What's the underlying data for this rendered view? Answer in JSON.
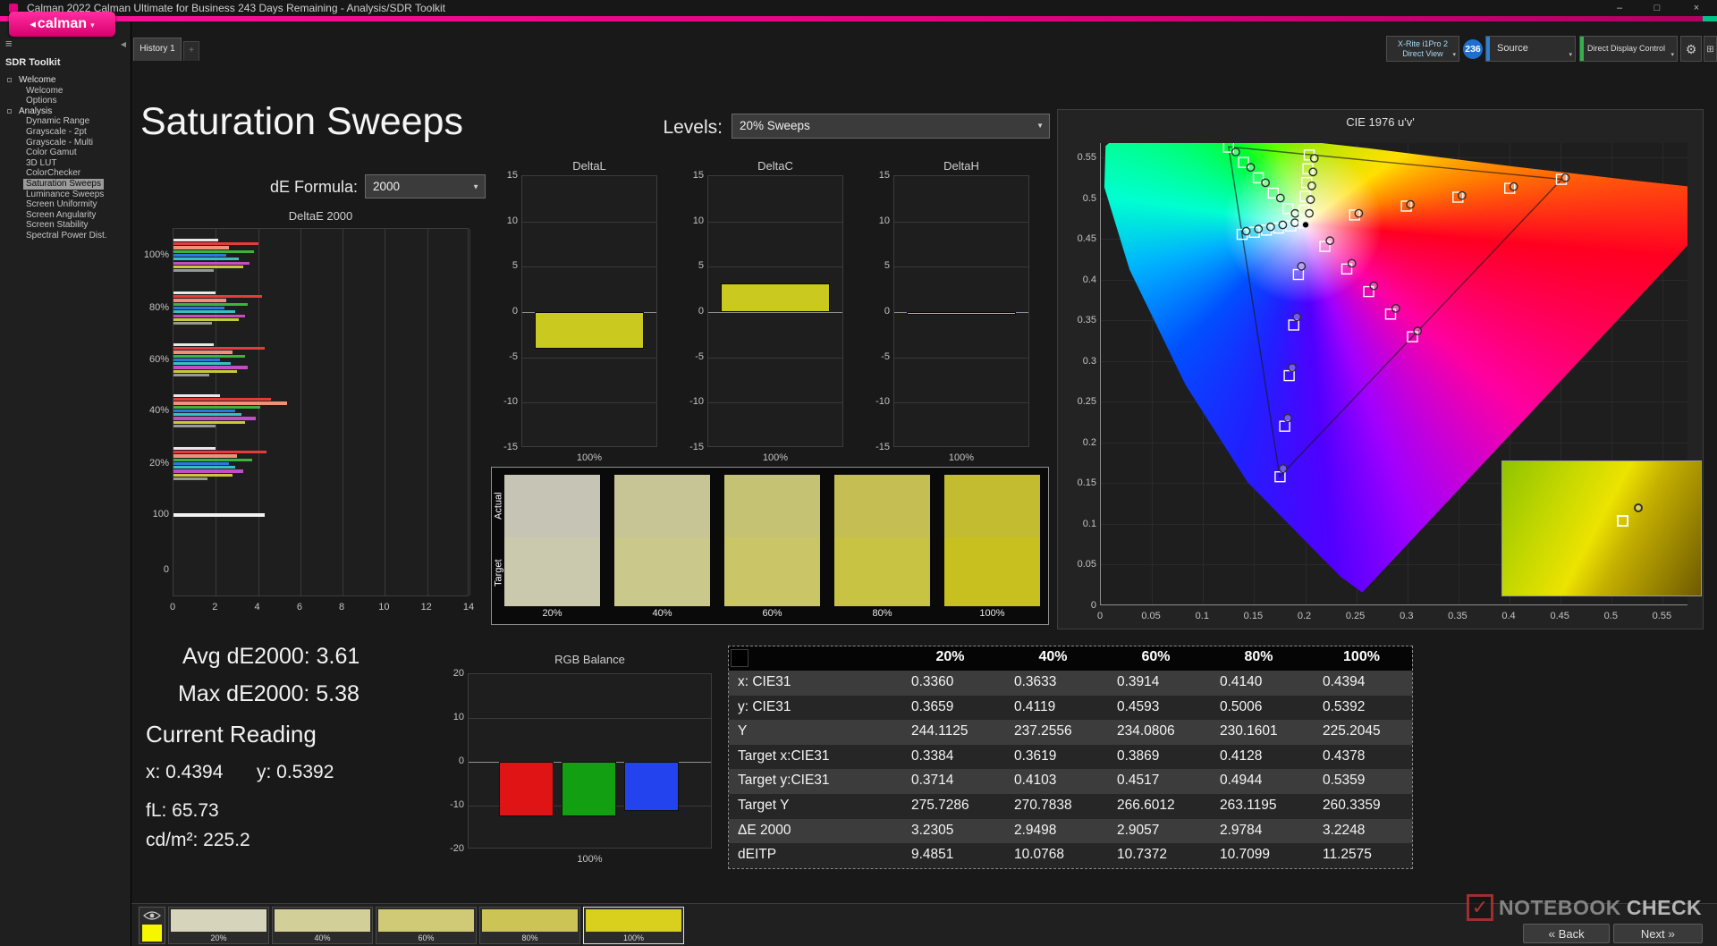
{
  "titlebar": {
    "title": "Calman 2022 Calman Ultimate for Business 243 Days Remaining  - Analysis/SDR Toolkit",
    "minimize": "–",
    "maximize": "□",
    "close": "×"
  },
  "logo": {
    "label": "calman",
    "accent": "#e6007e"
  },
  "tabs": {
    "history": "History 1"
  },
  "toolbar": {
    "meter_line1": "X-Rite i1Pro 2",
    "meter_line2": "Direct View",
    "badge": "236",
    "source_label": "Source",
    "display_control_label": "Direct Display Control"
  },
  "sidebar": {
    "header": "SDR Toolkit",
    "items": [
      {
        "label": "Welcome",
        "level": 0
      },
      {
        "label": "Welcome",
        "level": 1
      },
      {
        "label": "Options",
        "level": 1
      },
      {
        "label": "Analysis",
        "level": 0
      },
      {
        "label": "Dynamic Range",
        "level": 1
      },
      {
        "label": "Grayscale - 2pt",
        "level": 1
      },
      {
        "label": "Grayscale - Multi",
        "level": 1
      },
      {
        "label": "Color Gamut",
        "level": 1
      },
      {
        "label": "3D LUT",
        "level": 1
      },
      {
        "label": "ColorChecker",
        "level": 1
      },
      {
        "label": "Saturation Sweeps",
        "level": 1,
        "selected": true
      },
      {
        "label": "Luminance Sweeps",
        "level": 1
      },
      {
        "label": "Screen Uniformity",
        "level": 1
      },
      {
        "label": "Screen Angularity",
        "level": 1
      },
      {
        "label": "Screen Stability",
        "level": 1
      },
      {
        "label": "Spectral Power Dist.",
        "level": 1
      }
    ]
  },
  "page": {
    "title": "Saturation Sweeps",
    "levels_label": "Levels:",
    "levels_value": "20% Sweeps",
    "de_formula_label": "dE Formula:",
    "de_formula_value": "2000"
  },
  "readings": {
    "avg": "Avg dE2000: 3.61",
    "max": "Max dE2000: 5.38",
    "heading": "Current Reading",
    "x": "x: 0.4394",
    "y": "y: 0.5392",
    "fl": "fL: 65.73",
    "cdm2": "cd/m²: 225.2"
  },
  "table": {
    "columns": [
      "20%",
      "40%",
      "60%",
      "80%",
      "100%"
    ],
    "rows": [
      {
        "label": "x: CIE31",
        "values": [
          "0.3360",
          "0.3633",
          "0.3914",
          "0.4140",
          "0.4394"
        ]
      },
      {
        "label": "y: CIE31",
        "values": [
          "0.3659",
          "0.4119",
          "0.4593",
          "0.5006",
          "0.5392"
        ]
      },
      {
        "label": "Y",
        "values": [
          "244.1125",
          "237.2556",
          "234.0806",
          "230.1601",
          "225.2045"
        ]
      },
      {
        "label": "Target x:CIE31",
        "values": [
          "0.3384",
          "0.3619",
          "0.3869",
          "0.4128",
          "0.4378"
        ]
      },
      {
        "label": "Target y:CIE31",
        "values": [
          "0.3714",
          "0.4103",
          "0.4517",
          "0.4944",
          "0.5359"
        ]
      },
      {
        "label": "Target Y",
        "values": [
          "275.7286",
          "270.7838",
          "266.6012",
          "263.1195",
          "260.3359"
        ]
      },
      {
        "label": "ΔE 2000",
        "values": [
          "3.2305",
          "2.9498",
          "2.9057",
          "2.9784",
          "3.2248"
        ]
      },
      {
        "label": "dEITP",
        "values": [
          "9.4851",
          "10.0768",
          "10.7372",
          "10.7099",
          "11.2575"
        ]
      }
    ]
  },
  "bottom": {
    "back": "Back",
    "next": "Next",
    "swatches": [
      {
        "label": "20%",
        "color": "#d6d4ba"
      },
      {
        "label": "40%",
        "color": "#d3cf99"
      },
      {
        "label": "60%",
        "color": "#d0ca77"
      },
      {
        "label": "80%",
        "color": "#ccc455"
      },
      {
        "label": "100%",
        "color": "#d8d01d",
        "selected": true
      }
    ]
  },
  "watermark": {
    "text1": "NOTEBOOK",
    "text2": "CHECK"
  },
  "chart_data": [
    {
      "id": "deltaE2000",
      "type": "bar",
      "orientation": "horizontal",
      "title": "DeltaE 2000",
      "xlim": [
        0,
        14
      ],
      "xticks": [
        0,
        2,
        4,
        6,
        8,
        10,
        12,
        14
      ],
      "ylabels": [
        "100%",
        "80%",
        "60%",
        "40%",
        "20%",
        "100",
        "0"
      ],
      "palette": [
        "#e8e8e8",
        "#e43c3c",
        "#f0907a",
        "#3cb43c",
        "#2c78e0",
        "#38c0c0",
        "#c44cc4",
        "#c8c83c",
        "#989898"
      ],
      "groups": [
        {
          "label": "100%",
          "values": [
            2.1,
            4.0,
            2.6,
            3.8,
            2.5,
            3.1,
            3.6,
            3.3,
            1.9
          ]
        },
        {
          "label": "80%",
          "values": [
            2.0,
            4.2,
            2.5,
            3.5,
            2.4,
            2.9,
            3.4,
            3.1,
            1.8
          ]
        },
        {
          "label": "60%",
          "values": [
            1.9,
            4.3,
            2.8,
            3.4,
            2.2,
            2.7,
            3.5,
            3.0,
            1.7
          ]
        },
        {
          "label": "40%",
          "values": [
            2.2,
            4.6,
            5.38,
            4.1,
            2.9,
            3.2,
            3.9,
            3.4,
            2.0
          ]
        },
        {
          "label": "20%",
          "values": [
            2.0,
            4.4,
            3.0,
            3.7,
            2.6,
            2.9,
            3.3,
            2.8,
            1.6
          ]
        },
        {
          "label": "100",
          "values": [
            4.3
          ],
          "color": "#f2f2f2"
        }
      ]
    },
    {
      "id": "deltaL",
      "type": "bar",
      "title": "DeltaL",
      "category": "100%",
      "ylim": [
        -15,
        15
      ],
      "yticks": [
        15,
        10,
        5,
        0,
        -5,
        -10,
        -15
      ],
      "value": -4.0,
      "color": "#c9c920"
    },
    {
      "id": "deltaC",
      "type": "bar",
      "title": "DeltaC",
      "category": "100%",
      "ylim": [
        -15,
        15
      ],
      "yticks": [
        15,
        10,
        5,
        0,
        -5,
        -10,
        -15
      ],
      "value": 3.2,
      "color": "#c9c920"
    },
    {
      "id": "deltaH",
      "type": "bar",
      "title": "DeltaH",
      "category": "100%",
      "ylim": [
        -15,
        15
      ],
      "yticks": [
        15,
        10,
        5,
        0,
        -5,
        -10,
        -15
      ],
      "value": -0.3,
      "color": "#c9c920"
    },
    {
      "id": "rgb_balance",
      "type": "bar",
      "title": "RGB Balance",
      "category": "100%",
      "ylim": [
        -20,
        20
      ],
      "yticks": [
        20,
        10,
        0,
        -10,
        -20
      ],
      "series": [
        {
          "name": "Red",
          "value": -12.4,
          "color": "#e01414"
        },
        {
          "name": "Green",
          "value": -12.4,
          "color": "#12a012"
        },
        {
          "name": "Blue",
          "value": -11.2,
          "color": "#2343ee"
        }
      ]
    },
    {
      "id": "saturation_swatches",
      "type": "swatch-compare",
      "row_labels": [
        "Actual",
        "Target"
      ],
      "levels": [
        "20%",
        "40%",
        "60%",
        "80%",
        "100%"
      ],
      "actual": [
        "#c6c4b4",
        "#c7c495",
        "#c6c274",
        "#c5bf53",
        "#c3bb30"
      ],
      "target": [
        "#cac8ad",
        "#cbc88c",
        "#cac668",
        "#c9c344",
        "#c8c01f"
      ]
    },
    {
      "id": "cie",
      "type": "scatter",
      "title": "CIE 1976 u'v'",
      "xlim": [
        0,
        0.575
      ],
      "ylim": [
        0,
        0.5675
      ],
      "xticks": [
        0,
        0.05,
        0.1,
        0.15,
        0.2,
        0.25,
        0.3,
        0.35,
        0.4,
        0.45,
        0.5,
        0.55
      ],
      "xtick_labels": [
        "0",
        "0.05",
        "0.1",
        "0.15",
        "0.2",
        "0.25",
        "0.3",
        "0.35",
        "0.4",
        "0.45",
        "0.5",
        "0.55"
      ],
      "yticks": [
        0.55,
        0.5,
        0.45,
        0.4,
        0.35,
        0.3,
        0.25,
        0.2,
        0.15,
        0.1,
        0.05,
        0
      ],
      "ytick_labels": [
        "0.55",
        "0.5",
        "0.45",
        "0.4",
        "0.35",
        "0.3",
        "0.25",
        "0.2",
        "0.15",
        "0.1",
        "0.05",
        "0"
      ],
      "white_point": {
        "u": 0.1978,
        "v": 0.4683
      },
      "gamut_triangle": [
        [
          0.451,
          0.523
        ],
        [
          0.125,
          0.563
        ],
        [
          0.175,
          0.158
        ]
      ],
      "series": [
        {
          "name": "red-target",
          "marker": "square",
          "points": [
            [
              0.2484,
              0.4792
            ],
            [
              0.299,
              0.4901
            ],
            [
              0.3495,
              0.5011
            ],
            [
              0.4001,
              0.512
            ],
            [
              0.4507,
              0.5229
            ]
          ]
        },
        {
          "name": "red-measured",
          "marker": "circle",
          "points": [
            [
              0.2524,
              0.4812
            ],
            [
              0.303,
              0.4921
            ],
            [
              0.3535,
              0.5031
            ],
            [
              0.4041,
              0.514
            ],
            [
              0.4547,
              0.5249
            ]
          ]
        },
        {
          "name": "green-target",
          "marker": "square",
          "points": [
            [
              0.1832,
              0.4871
            ],
            [
              0.1687,
              0.506
            ],
            [
              0.1541,
              0.5248
            ],
            [
              0.1396,
              0.5437
            ],
            [
              0.125,
              0.5625
            ]
          ]
        },
        {
          "name": "green-measured",
          "marker": "circle",
          "points": [
            [
              0.1902,
              0.4811
            ],
            [
              0.1757,
              0.5
            ],
            [
              0.1611,
              0.5188
            ],
            [
              0.1466,
              0.5377
            ],
            [
              0.132,
              0.5565
            ]
          ]
        },
        {
          "name": "blue-target",
          "marker": "square",
          "points": [
            [
              0.1933,
              0.4062
            ],
            [
              0.1888,
              0.3441
            ],
            [
              0.1843,
              0.282
            ],
            [
              0.1799,
              0.2199
            ],
            [
              0.1754,
              0.1579
            ]
          ]
        },
        {
          "name": "blue-measured",
          "marker": "circle",
          "points": [
            [
              0.1963,
              0.4162
            ],
            [
              0.1918,
              0.3541
            ],
            [
              0.1873,
              0.292
            ],
            [
              0.1829,
              0.2299
            ],
            [
              0.1784,
              0.1679
            ]
          ]
        },
        {
          "name": "cyan-target",
          "marker": "square",
          "points": [
            [
              0.1859,
              0.4657
            ],
            [
              0.174,
              0.4631
            ],
            [
              0.1621,
              0.4606
            ],
            [
              0.1502,
              0.458
            ],
            [
              0.1383,
              0.4554
            ]
          ]
        },
        {
          "name": "cyan-measured",
          "marker": "circle",
          "points": [
            [
              0.1899,
              0.4697
            ],
            [
              0.178,
              0.4671
            ],
            [
              0.1661,
              0.4646
            ],
            [
              0.1542,
              0.462
            ],
            [
              0.1423,
              0.4594
            ]
          ]
        },
        {
          "name": "magenta-target",
          "marker": "square",
          "points": [
            [
              0.2192,
              0.4406
            ],
            [
              0.2407,
              0.4129
            ],
            [
              0.2621,
              0.3852
            ],
            [
              0.2836,
              0.3575
            ],
            [
              0.305,
              0.3298
            ]
          ]
        },
        {
          "name": "magenta-measured",
          "marker": "circle",
          "points": [
            [
              0.2242,
              0.4476
            ],
            [
              0.2457,
              0.4199
            ],
            [
              0.2671,
              0.3922
            ],
            [
              0.2886,
              0.3645
            ],
            [
              0.31,
              0.3368
            ]
          ]
        },
        {
          "name": "yellow-target",
          "marker": "square",
          "points": [
            [
              0.199,
              0.4852
            ],
            [
              0.2002,
              0.5021
            ],
            [
              0.2015,
              0.519
            ],
            [
              0.2027,
              0.536
            ],
            [
              0.2039,
              0.5529
            ]
          ]
        },
        {
          "name": "yellow-measured",
          "marker": "circle",
          "points": [
            [
              0.204,
              0.4812
            ],
            [
              0.2052,
              0.4981
            ],
            [
              0.2065,
              0.515
            ],
            [
              0.2077,
              0.532
            ],
            [
              0.2089,
              0.5489
            ]
          ]
        }
      ]
    }
  ]
}
